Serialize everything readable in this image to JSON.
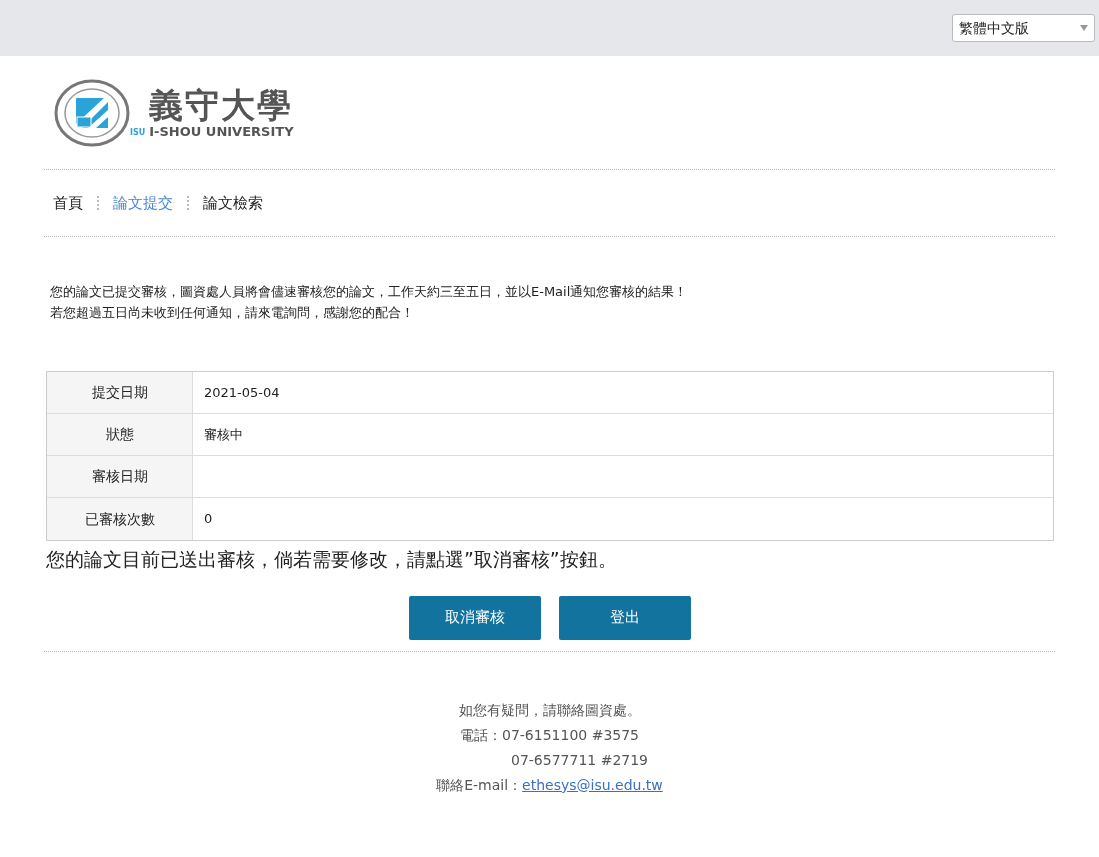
{
  "language_select": {
    "value": "繁體中文版"
  },
  "logo": {
    "name_zh": "義守大學",
    "name_en": "I-SHOU UNIVERSITY",
    "seal_text": "ISU"
  },
  "nav": [
    {
      "label": "首頁",
      "selected": false
    },
    {
      "label": "論文提交",
      "selected": true
    },
    {
      "label": "論文檢索",
      "selected": false
    }
  ],
  "notice": [
    "您的論文已提交審核，圖資處人員將會儘速審核您的論文，工作天約三至五日，並以E-Mail通知您審核的結果！",
    "若您超過五日尚未收到任何通知，請來電詢問，感謝您的配合！"
  ],
  "table": {
    "rows": [
      {
        "label": "提交日期",
        "value": "2021-05-04"
      },
      {
        "label": "狀態",
        "value": "審核中"
      },
      {
        "label": "審核日期"
      },
      {
        "label": "已審核次數",
        "value": "0"
      }
    ]
  },
  "message": "您的論文目前已送出審核，倘若需要修改，請點選”取消審核”按鈕。",
  "buttons": [
    "取消審核",
    "登出"
  ],
  "footer": {
    "lines": [
      "如您有疑問，請聯絡圖資處。",
      "電話：07-6151100 #3575",
      "07-6577711 #2719"
    ],
    "email_label": "聯絡E-mail：",
    "email": "ethesys@isu.edu.tw"
  }
}
